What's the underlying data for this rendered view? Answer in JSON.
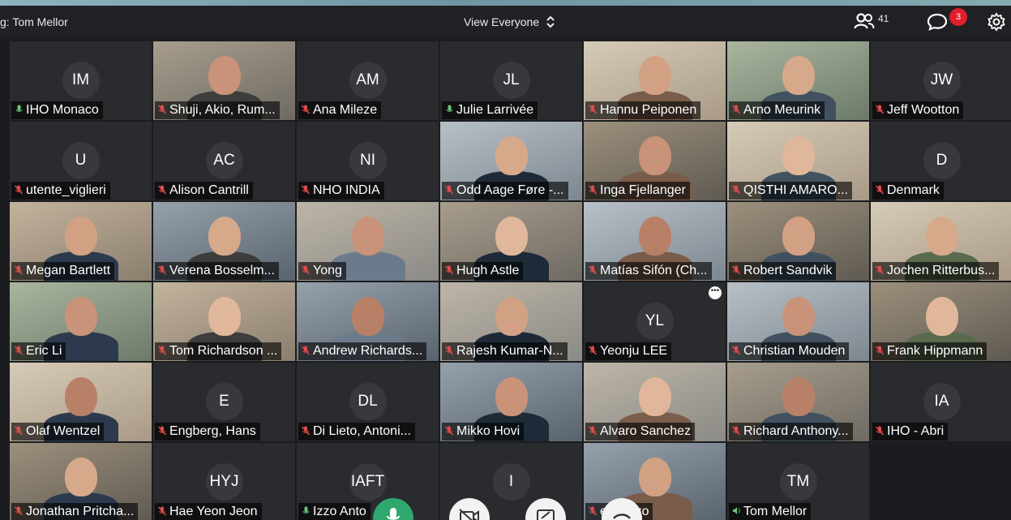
{
  "header": {
    "title": "g: Tom Mellor",
    "view_label": "View Everyone",
    "participants_count": "41",
    "chat_badge": "3"
  },
  "participants": [
    {
      "name": "IHO Monaco",
      "initials": "IM",
      "mic": "on",
      "video": false
    },
    {
      "name": "Shuji, Akio, Rum...",
      "initials": "",
      "mic": "off",
      "video": true
    },
    {
      "name": "Ana Mileze",
      "initials": "AM",
      "mic": "off",
      "video": false
    },
    {
      "name": "Julie Larrivée",
      "initials": "JL",
      "mic": "on",
      "video": false
    },
    {
      "name": "Hannu Peiponen",
      "initials": "",
      "mic": "off",
      "video": true
    },
    {
      "name": "Arno Meurink",
      "initials": "",
      "mic": "off",
      "video": true
    },
    {
      "name": "Jeff Wootton",
      "initials": "JW",
      "mic": "off",
      "video": false
    },
    {
      "name": "utente_viglieri",
      "initials": "U",
      "mic": "off",
      "video": false
    },
    {
      "name": "Alison Cantrill",
      "initials": "AC",
      "mic": "off",
      "video": false
    },
    {
      "name": "NHO INDIA",
      "initials": "NI",
      "mic": "off",
      "video": false
    },
    {
      "name": "Odd Aage Føre -...",
      "initials": "",
      "mic": "off",
      "video": true
    },
    {
      "name": "Inga Fjellanger",
      "initials": "",
      "mic": "off",
      "video": true
    },
    {
      "name": "QISTHI AMARO...",
      "initials": "",
      "mic": "off",
      "video": true
    },
    {
      "name": "Denmark",
      "initials": "D",
      "mic": "off",
      "video": false
    },
    {
      "name": "Megan Bartlett",
      "initials": "",
      "mic": "off",
      "video": true
    },
    {
      "name": "Verena Bosselm...",
      "initials": "",
      "mic": "off",
      "video": true
    },
    {
      "name": "Yong",
      "initials": "",
      "mic": "off",
      "video": true
    },
    {
      "name": "Hugh Astle",
      "initials": "",
      "mic": "off",
      "video": true
    },
    {
      "name": "Matías Sifón (Ch...",
      "initials": "",
      "mic": "off",
      "video": true
    },
    {
      "name": "Robert Sandvik",
      "initials": "",
      "mic": "off",
      "video": true
    },
    {
      "name": "Jochen Ritterbus...",
      "initials": "",
      "mic": "off",
      "video": true
    },
    {
      "name": "Eric Li",
      "initials": "",
      "mic": "off",
      "video": true
    },
    {
      "name": "Tom Richardson ...",
      "initials": "",
      "mic": "off",
      "video": true
    },
    {
      "name": "Andrew Richards...",
      "initials": "",
      "mic": "off",
      "video": true
    },
    {
      "name": "Rajesh Kumar-N...",
      "initials": "",
      "mic": "off",
      "video": true
    },
    {
      "name": "Yeonju LEE",
      "initials": "YL",
      "mic": "off",
      "video": false,
      "more": "•••"
    },
    {
      "name": "Christian Mouden",
      "initials": "",
      "mic": "off",
      "video": true
    },
    {
      "name": "Frank Hippmann",
      "initials": "",
      "mic": "off",
      "video": true
    },
    {
      "name": "Olaf Wentzel",
      "initials": "",
      "mic": "off",
      "video": true
    },
    {
      "name": "Engberg, Hans",
      "initials": "E",
      "mic": "off",
      "video": false
    },
    {
      "name": "Di Lieto, Antoni...",
      "initials": "DL",
      "mic": "off",
      "video": false
    },
    {
      "name": "Mikko Hovi",
      "initials": "",
      "mic": "off",
      "video": true
    },
    {
      "name": "Alvaro Sanchez",
      "initials": "",
      "mic": "off",
      "video": true
    },
    {
      "name": "Richard Anthony...",
      "initials": "",
      "mic": "off",
      "video": true
    },
    {
      "name": "IHO - Abri",
      "initials": "IA",
      "mic": "off",
      "video": false
    },
    {
      "name": "Jonathan Pritcha...",
      "initials": "",
      "mic": "off",
      "video": true
    },
    {
      "name": "Hae Yeon Jeon",
      "initials": "HYJ",
      "mic": "off",
      "video": false
    },
    {
      "name": "Izzo Anto",
      "initials": "IAFT",
      "mic": "on",
      "video": false
    },
    {
      "name": "",
      "initials": "I",
      "mic": "off",
      "video": false
    },
    {
      "name": "etta Izzo",
      "initials": "",
      "mic": "off",
      "video": true
    },
    {
      "name": "Tom Mellor",
      "initials": "TM",
      "mic": "speaking",
      "video": false
    }
  ],
  "colors": {
    "tile_bg": "#2a2b2f",
    "mic_muted": "#e24b4b",
    "mic_on": "#6cc77a",
    "badge": "#e0202a",
    "mic_button": "#2ea86f"
  }
}
